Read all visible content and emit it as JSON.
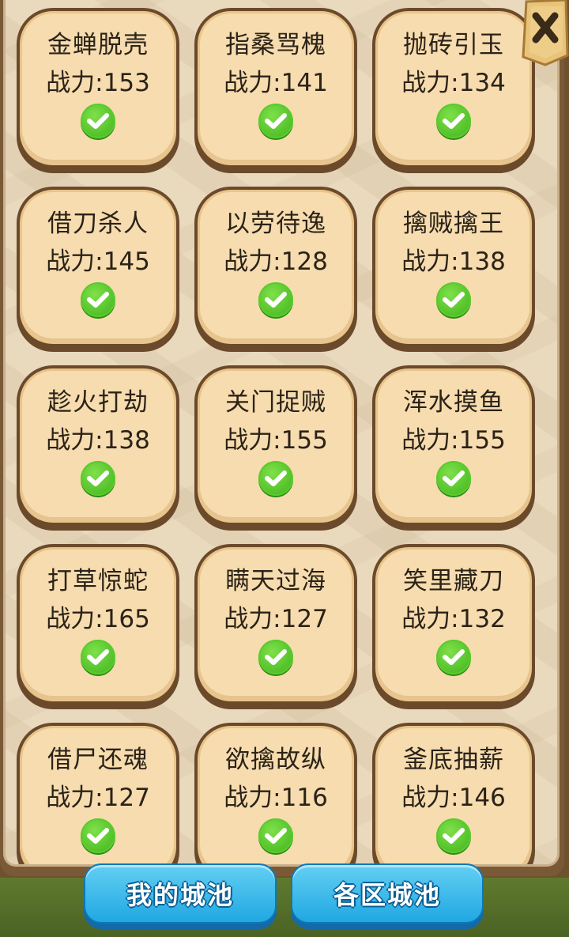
{
  "stratagems": [
    {
      "name": "金蝉脱壳",
      "power": "战力:153",
      "cleared": true
    },
    {
      "name": "指桑骂槐",
      "power": "战力:141",
      "cleared": true
    },
    {
      "name": "抛砖引玉",
      "power": "战力:134",
      "cleared": true
    },
    {
      "name": "借刀杀人",
      "power": "战力:145",
      "cleared": true
    },
    {
      "name": "以劳待逸",
      "power": "战力:128",
      "cleared": true
    },
    {
      "name": "擒贼擒王",
      "power": "战力:138",
      "cleared": true
    },
    {
      "name": "趁火打劫",
      "power": "战力:138",
      "cleared": true
    },
    {
      "name": "关门捉贼",
      "power": "战力:155",
      "cleared": true
    },
    {
      "name": "浑水摸鱼",
      "power": "战力:155",
      "cleared": true
    },
    {
      "name": "打草惊蛇",
      "power": "战力:165",
      "cleared": true
    },
    {
      "name": "瞒天过海",
      "power": "战力:127",
      "cleared": true
    },
    {
      "name": "笑里藏刀",
      "power": "战力:132",
      "cleared": true
    },
    {
      "name": "借尸还魂",
      "power": "战力:127",
      "cleared": true
    },
    {
      "name": "欲擒故纵",
      "power": "战力:116",
      "cleared": true
    },
    {
      "name": "釜底抽薪",
      "power": "战力:146",
      "cleared": true
    }
  ],
  "tabs": {
    "my_cities": "我的城池",
    "all_regions": "各区城池"
  },
  "icons": {
    "close": "close-icon",
    "check": "check-icon"
  },
  "colors": {
    "card_fill": "#f6dcae",
    "card_border": "#6b4a2c",
    "check_green": "#3db21a",
    "button_blue": "#20a8e2"
  }
}
